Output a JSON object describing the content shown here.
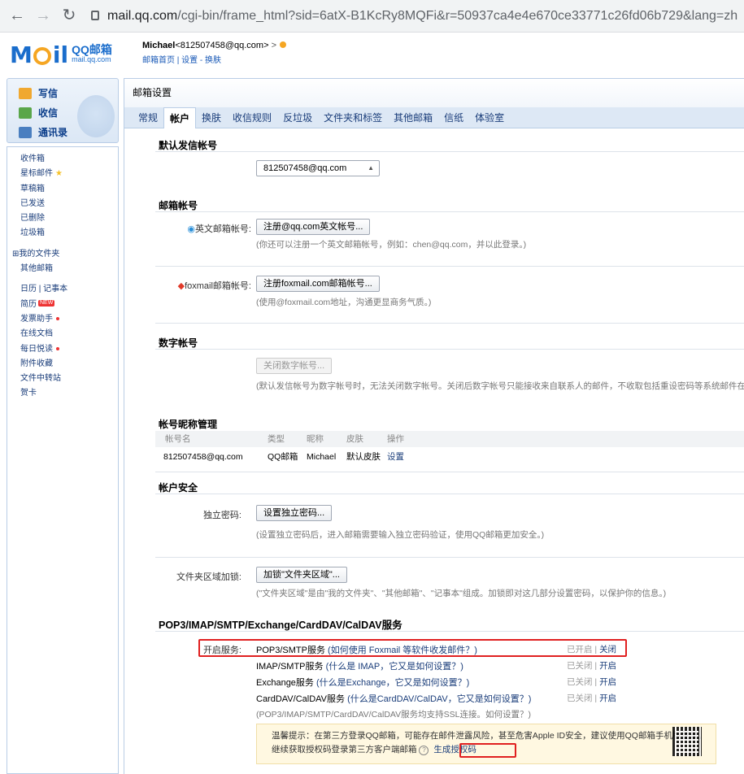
{
  "browser": {
    "url_domain": "mail.qq.com",
    "url_path": "/cgi-bin/frame_html?sid=6atX-B1KcRy8MQFi&r=50937ca4e4e670ce33771c26fd06b729&lang=zh"
  },
  "header": {
    "logo_m": "M",
    "logo_il": "il",
    "logo_qq": "QQ邮箱",
    "logo_domain": "mail.qq.com",
    "user_name": "Michael",
    "user_email": "<812507458@qq.com>",
    "links": "邮箱首页 | 设置 - 换肤"
  },
  "sidebar": {
    "top": [
      "写信",
      "收信",
      "通讯录"
    ],
    "items": [
      "收件箱",
      "星标邮件",
      "草稿箱",
      "已发送",
      "已删除",
      "垃圾箱"
    ],
    "folders": [
      "⊞我的文件夹",
      "其他邮箱"
    ],
    "tools": [
      "日历 | 记事本",
      "简历",
      "发票助手",
      "在线文档",
      "每日悦读",
      "附件收藏",
      "文件中转站",
      "贺卡"
    ],
    "new_tag": "NEW"
  },
  "main": {
    "title": "邮箱设置",
    "tabs": [
      "常规",
      "帐户",
      "换肤",
      "收信规则",
      "反垃圾",
      "文件夹和标签",
      "其他邮箱",
      "信纸",
      "体验室"
    ],
    "default_sender_title": "默认发信帐号",
    "default_sender_value": "812507458@qq.com",
    "mailbox_title": "邮箱帐号",
    "english_label": "英文邮箱帐号:",
    "english_btn": "注册@qq.com英文帐号...",
    "english_hint": "(你还可以注册一个英文邮箱帐号，例如：chen@qq.com，并以此登录。)",
    "foxmail_label": "foxmail邮箱帐号:",
    "foxmail_btn": "注册foxmail.com邮箱帐号...",
    "foxmail_hint": "(使用@foxmail.com地址，沟通更显商务气质。)",
    "digital_title": "数字帐号",
    "digital_btn": "关闭数字帐号...",
    "digital_hint": "(默认发信帐号为数字帐号时，无法关闭数字帐号。关闭后数字帐号只能接收来自联系人的邮件，不收取包括重设密码等系统邮件在内的其他所",
    "nick_title": "帐号昵称管理",
    "nick_headers": [
      "帐号名",
      "类型",
      "昵称",
      "皮肤",
      "操作"
    ],
    "nick_row": [
      "812507458@qq.com",
      "QQ邮箱",
      "Michael",
      "默认皮肤",
      "设置"
    ],
    "security_title": "帐户安全",
    "pwd_label": "独立密码:",
    "pwd_btn": "设置独立密码...",
    "pwd_hint": "(设置独立密码后，进入邮箱需要输入独立密码验证，使用QQ邮箱更加安全。)",
    "folder_label": "文件夹区域加锁:",
    "folder_btn": "加锁\"文件夹区域\"...",
    "folder_hint": "(\"文件夹区域\"是由\"我的文件夹\"、\"其他邮箱\"、\"记事本\"组成。加锁即对这几部分设置密码，以保护你的信息。)",
    "pop_title": "POP3/IMAP/SMTP/Exchange/CardDAV/CalDAV服务",
    "open_label": "开启服务:",
    "services": [
      {
        "name": "POP3/SMTP服务",
        "q": "(如何使用 Foxmail 等软件收发邮件？)",
        "status": "已开启",
        "action": "关闭"
      },
      {
        "name": "IMAP/SMTP服务",
        "q": "(什么是 IMAP，它又是如何设置？)",
        "status": "已关闭",
        "action": "开启"
      },
      {
        "name": "Exchange服务",
        "q": "(什么是Exchange，它又是如何设置？)",
        "status": "已关闭",
        "action": "开启"
      },
      {
        "name": "CardDAV/CalDAV服务",
        "q": "(什么是CardDAV/CalDAV，它又是如何设置？)",
        "status": "已关闭",
        "action": "开启"
      }
    ],
    "ssl_hint": "(POP3/IMAP/SMTP/CardDAV/CalDAV服务均支持SSL连接。如何设置？)",
    "warn_line1": "温馨提示：在第三方登录QQ邮箱，可能存在邮件泄露风险，甚至危害Apple ID安全，建议使用QQ邮箱手机版登录。",
    "warn_line2": "继续获取授权码登录第三方客户端邮箱",
    "warn_q": "?",
    "gen_code": "生成授权码"
  }
}
